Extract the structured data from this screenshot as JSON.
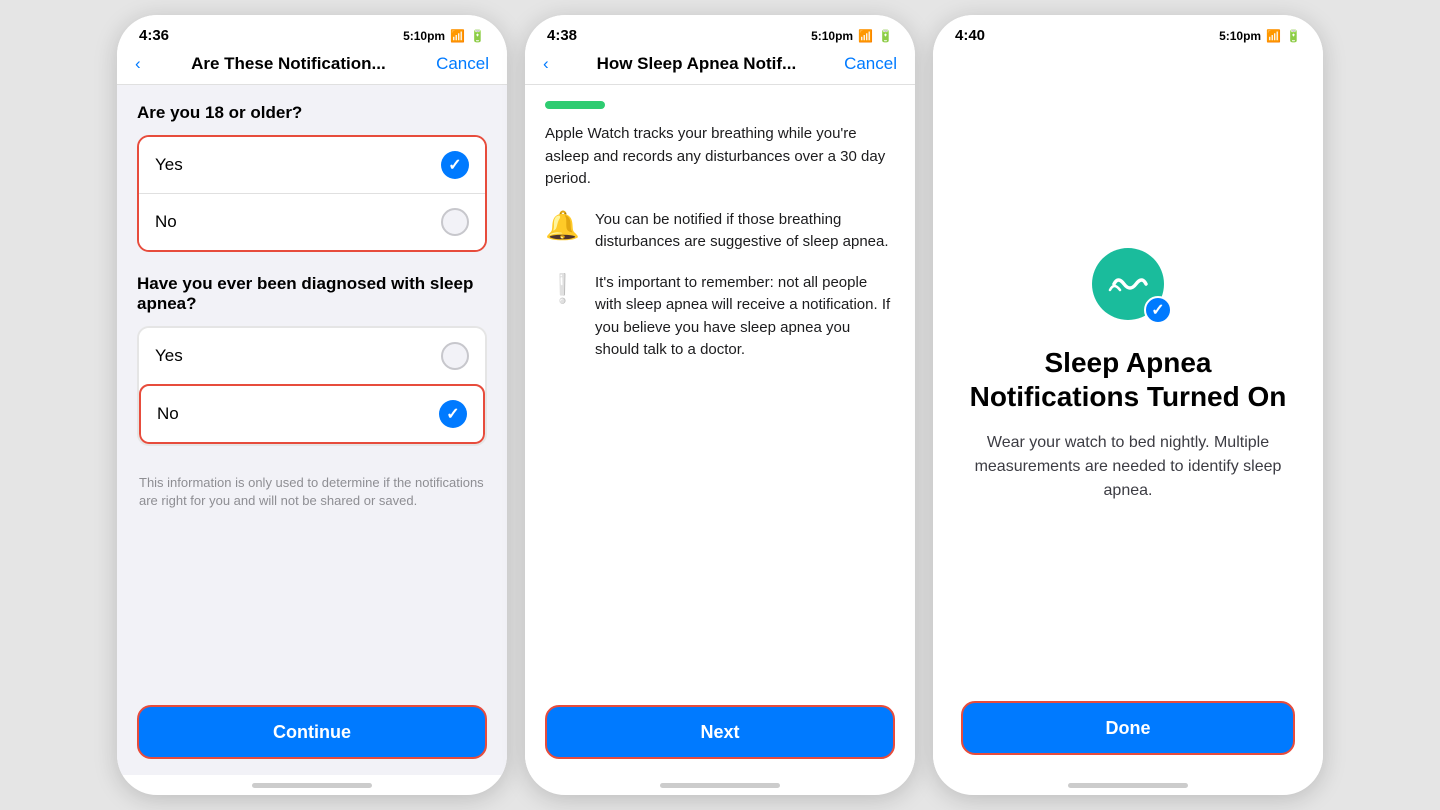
{
  "screen1": {
    "time": "4:36",
    "status_right": "5:10pm",
    "nav_back": "‹",
    "nav_title": "Are These Notification...",
    "nav_cancel": "Cancel",
    "q1_label": "Are you 18 or older?",
    "q1_yes": "Yes",
    "q1_no": "No",
    "q2_label": "Have you ever been diagnosed with sleep apnea?",
    "q2_yes": "Yes",
    "q2_no": "No",
    "disclaimer": "This information is only used to determine if the notifications are right for you and will not be shared or saved.",
    "continue_btn": "Continue"
  },
  "screen2": {
    "time": "4:38",
    "status_right": "5:10pm",
    "nav_back": "‹",
    "nav_title": "How Sleep Apnea Notif...",
    "nav_cancel": "Cancel",
    "block1_text": "Apple Watch tracks your breathing while you're asleep and records any disturbances over a 30 day period.",
    "block2_icon": "🔔",
    "block2_text": "You can be notified if those breathing disturbances are suggestive of sleep apnea.",
    "block3_icon": "❕",
    "block3_text": "It's important to remember: not all people with sleep apnea will receive a notification. If you believe you have sleep apnea you should talk to a doctor.",
    "next_btn": "Next"
  },
  "screen3": {
    "time": "4:40",
    "status_right": "5:10pm",
    "icon_emoji": "〰",
    "title": "Sleep Apnea Notifications Turned On",
    "subtitle": "Wear your watch to bed nightly. Multiple measurements are needed to identify sleep apnea.",
    "done_btn": "Done"
  }
}
